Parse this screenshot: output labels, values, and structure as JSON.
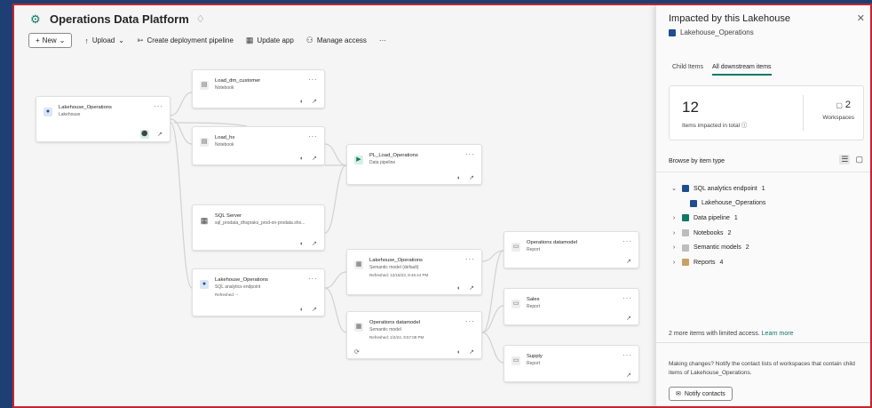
{
  "workspace": {
    "title": "Operations Data Platform"
  },
  "toolbar": {
    "new_label": "New",
    "upload_label": "Upload",
    "deploy_label": "Create deployment pipeline",
    "update_label": "Update app",
    "access_label": "Manage access",
    "more_label": "···"
  },
  "nodes": {
    "lakehouse": {
      "name": "Lakehouse_Operations",
      "type": "Lakehouse"
    },
    "load_dm": {
      "name": "Load_dm_customer",
      "type": "Notebook"
    },
    "load_hs": {
      "name": "Load_hs",
      "type": "Notebook"
    },
    "pl_load": {
      "name": "PL_Load_Operations",
      "type": "Data pipeline"
    },
    "sql_server": {
      "name": "SQL Server",
      "type": "sql_prodata_dhspraks_prod-on-prodata.sho..."
    },
    "sql_endpoint": {
      "name": "Lakehouse_Operations",
      "type": "SQL analytics endpoint",
      "refreshed": "Refreshed: --"
    },
    "sem_default": {
      "name": "Lakehouse_Operations",
      "type": "Semantic model (default)",
      "refreshed": "Refreshed: 12/18/23, 8:46:44 PM"
    },
    "ops_datamodel": {
      "name": "Operations datamodel",
      "type": "Semantic model",
      "refreshed": "Refreshed: 1/2/24, 9:57:09 PM"
    },
    "ops_report": {
      "name": "Operations datamodel",
      "type": "Report"
    },
    "sales": {
      "name": "Sales",
      "type": "Report"
    },
    "supply": {
      "name": "Supply",
      "type": "Report"
    }
  },
  "panel": {
    "title": "Impacted by this Lakehouse",
    "subtitle": "Lakehouse_Operations",
    "tabs": [
      "Child Items",
      "All downstream items"
    ],
    "stats": {
      "items_total": "12",
      "items_label": "Items impacted in total",
      "workspaces": "2",
      "workspaces_label": "Workspaces"
    },
    "browse_label": "Browse by item type",
    "tree": [
      {
        "label": "SQL analytics endpoint",
        "count": "1",
        "expanded": true
      },
      {
        "label": "Lakehouse_Operations",
        "count": "",
        "child": true
      },
      {
        "label": "Data pipeline",
        "count": "1"
      },
      {
        "label": "Notebooks",
        "count": "2"
      },
      {
        "label": "Semantic models",
        "count": "2"
      },
      {
        "label": "Reports",
        "count": "4"
      }
    ],
    "limited_text": "2 more items with limited access.",
    "learn_more": "Learn more",
    "note": "Making changes? Notify the contact lists of workspaces that contain child items of Lakehouse_Operations.",
    "notify_label": "Notify contacts"
  },
  "colors": {
    "accent": "#117865",
    "lakehouse": "#1d4e8e",
    "frame": "#c4262e"
  }
}
